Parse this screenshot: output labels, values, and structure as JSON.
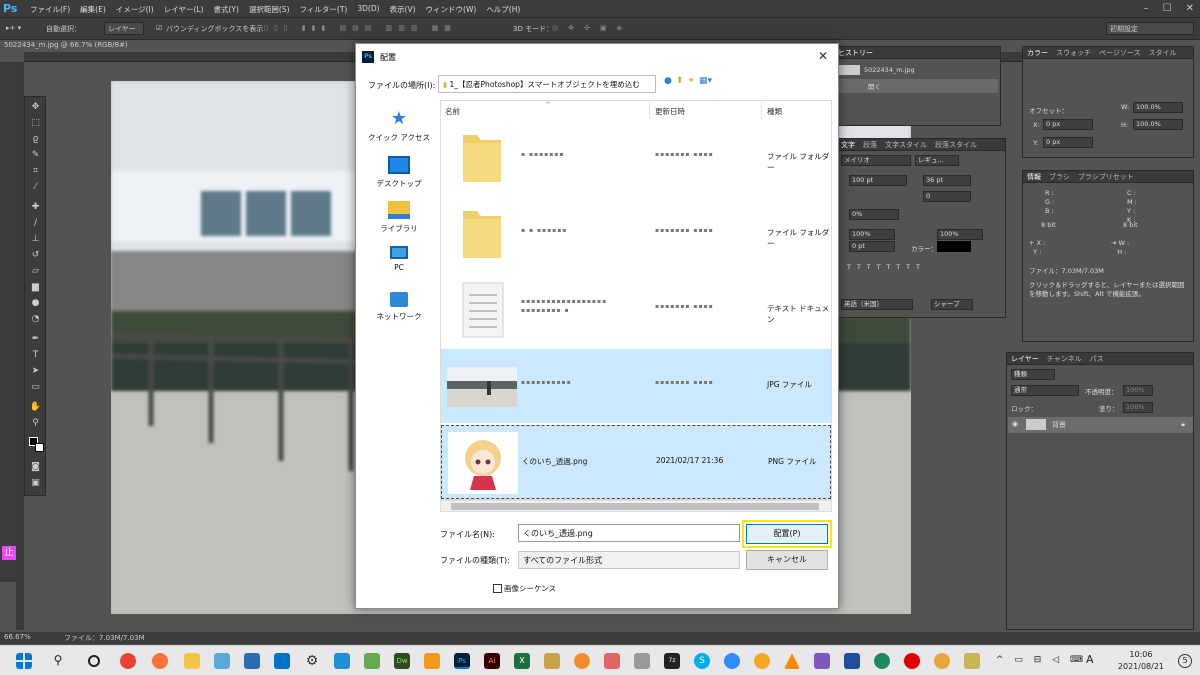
{
  "app": {
    "logo": "Ps"
  },
  "menubar": {
    "items": [
      "ファイル(F)",
      "編集(E)",
      "イメージ(I)",
      "レイヤー(L)",
      "書式(Y)",
      "選択範囲(S)",
      "フィルター(T)",
      "3D(D)",
      "表示(V)",
      "ウィンドウ(W)",
      "ヘルプ(H)"
    ]
  },
  "options": {
    "auto_select": "自動選択：",
    "layer_value": "レイヤー",
    "bbox": "バウンディングボックスを表示",
    "mode3d": "3D モード：",
    "workspace": "初期設定"
  },
  "document": {
    "tab": "5022434_m.jpg @ 66.7% (RGB/8#)",
    "zoom": "66.67%",
    "file_info": "ファイル：7.03M/7.03M"
  },
  "history_panel": {
    "tab": "ヒストリー",
    "snapshot": "5022434_m.jpg",
    "step": "開く"
  },
  "properties_panel": {
    "tabs": [
      "カラー",
      "スウォッチ",
      "ページソース",
      "スタイル"
    ],
    "offset": "オフセット：",
    "w": "W:",
    "w_val": "100.0%",
    "h": "H:",
    "h_val": "100.0%",
    "x": "X:",
    "x_val": "0 px",
    "y": "Y:",
    "y_val": "0 px"
  },
  "char_panel": {
    "tabs": [
      "文字",
      "段落",
      "文字スタイル",
      "段落スタイル"
    ],
    "font": "メイリオ",
    "style": "レギュ...",
    "size": "100 pt",
    "leading": "36 pt",
    "tracking": "0",
    "scale_pct": "0%",
    "v_scale": "100%",
    "h_scale": "100%",
    "baseline": "0 pt",
    "color_label": "カラー：",
    "lang": "英語（米国）",
    "aa": "シャープ"
  },
  "info_panel": {
    "tabs": [
      "情報",
      "ブラシ",
      "ブラシプリセット"
    ],
    "bits": "8 bit",
    "file": "ファイル：7.03M/7.03M",
    "hint": "クリック＆ドラッグすると、レイヤーまたは選択範囲を移動します。Shift、Alt で機能拡張。"
  },
  "layers_panel": {
    "tabs": [
      "レイヤー",
      "チャンネル",
      "パス"
    ],
    "kind": "種類",
    "blend": "通常",
    "opacity_label": "不透明度：",
    "opacity": "100%",
    "lock_label": "ロック：",
    "fill_label": "塗り：",
    "fill": "100%",
    "layer_name": "背景"
  },
  "dialog": {
    "title": "配置",
    "location_label": "ファイルの場所(I):",
    "location_value": "1_【忍者Photoshop】スマートオブジェクトを埋め込む",
    "nav": [
      "クイック アクセス",
      "デスクトップ",
      "ライブラリ",
      "PC",
      "ネットワーク"
    ],
    "col_name": "名前",
    "col_date": "更新日時",
    "col_type": "種類",
    "files": [
      {
        "name": "",
        "date": "",
        "type": "ファイル フォルダー"
      },
      {
        "name": "",
        "date": "",
        "type": "ファイル フォルダー"
      },
      {
        "name": "",
        "date": "",
        "type": "テキスト ドキュメン"
      },
      {
        "name": "",
        "date": "",
        "type": "JPG ファイル"
      },
      {
        "name": "くのいち_透過.png",
        "date": "2021/02/17 21:36",
        "type": "PNG ファイル"
      }
    ],
    "filename_label": "ファイル名(N):",
    "filename_value": "くのいち_透過.png",
    "filetype_label": "ファイルの種類(T):",
    "filetype_value": "すべてのファイル形式",
    "place_button": "配置(P)",
    "cancel_button": "キャンセル",
    "sequence_label": "画像シーケンス"
  },
  "taskbar": {
    "time": "10:06",
    "date": "2021/08/21",
    "ime": "A",
    "notify": "5"
  },
  "colors": {
    "ps_dark": "#535353",
    "ps_panel": "#3c3c3c",
    "selection": "#cce8ff",
    "highlight": "#ffe600",
    "ps_blue": "#31a8ff"
  }
}
